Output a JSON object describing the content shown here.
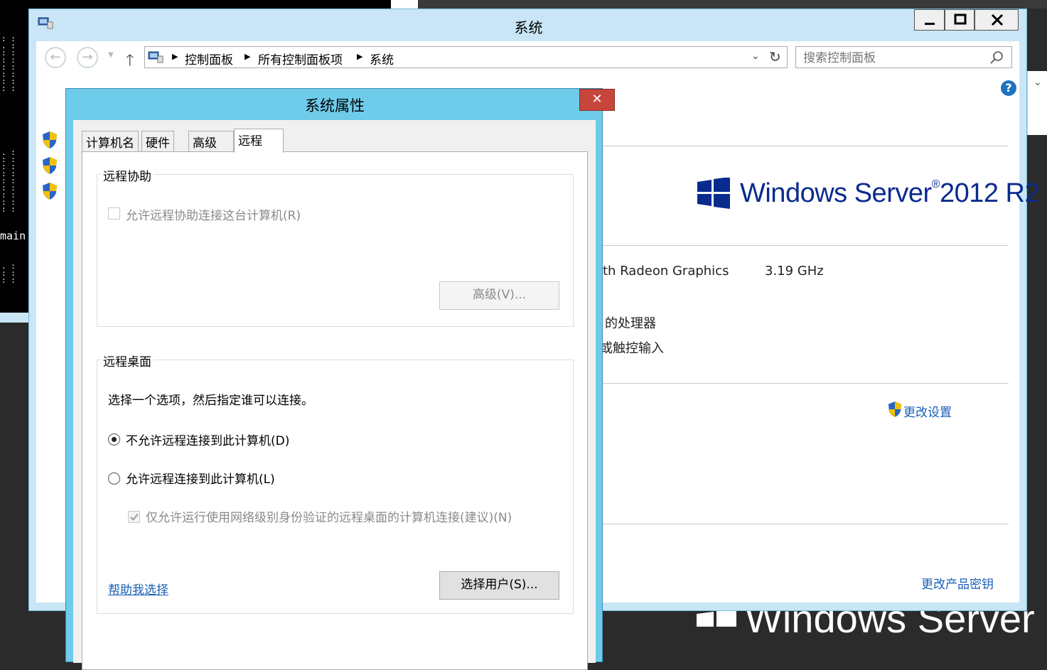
{
  "terminal": {
    "text": "main"
  },
  "window": {
    "title": "系统",
    "caption_min": "▁",
    "caption_max": "▢",
    "caption_close": "✕"
  },
  "navbar": {
    "breadcrumbs": [
      "控制面板",
      "所有控制面板项",
      "系统"
    ],
    "search_placeholder": "搜索控制面板"
  },
  "system_info": {
    "logo_text": "Windows Server",
    "logo_version": "2012 R2",
    "cpu_name": "th Radeon Graphics",
    "cpu_speed": "3.19 GHz",
    "processor_type": "的处理器",
    "pen_touch": "或触控输入",
    "change_settings": "更改设置",
    "change_product_key": "更改产品密钥"
  },
  "dialog": {
    "title": "系统属性",
    "close_label": "✕",
    "tabs": [
      "计算机名",
      "硬件",
      "高级",
      "远程"
    ],
    "active_tab": "远程",
    "remote_assistance": {
      "group_label": "远程协助",
      "allow_checkbox": "允许远程协助连接这台计算机(R)",
      "allow_checked": false,
      "advanced_button": "高级(V)..."
    },
    "remote_desktop": {
      "group_label": "远程桌面",
      "instruction": "选择一个选项，然后指定谁可以连接。",
      "option_deny": "不允许远程连接到此计算机(D)",
      "option_allow": "允许远程连接到此计算机(L)",
      "selected_option": "不允许远程连接到此计算机(D)",
      "nla_checkbox": "仅允许运行使用网络级别身份验证的远程桌面的计算机连接(建议)(N)",
      "nla_checked": true,
      "help_link": "帮助我选择",
      "select_users_button": "选择用户(S)..."
    }
  },
  "colors": {
    "dialog_frame": "#6fcbea",
    "window_frame": "#c8e6f5",
    "close_red": "#c7463c",
    "link_blue": "#1a5fb4",
    "logo_blue": "#0a2b8e"
  }
}
